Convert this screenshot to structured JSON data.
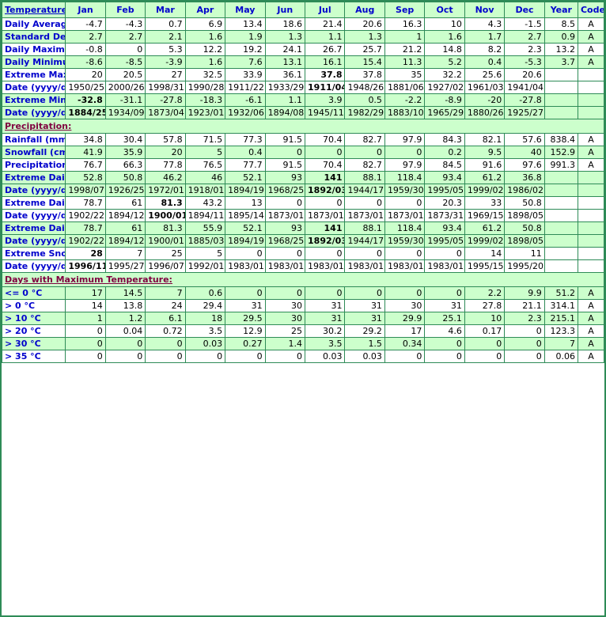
{
  "header": {
    "label": "Temperature:",
    "columns": [
      "Jan",
      "Feb",
      "Mar",
      "Apr",
      "May",
      "Jun",
      "Jul",
      "Aug",
      "Sep",
      "Oct",
      "Nov",
      "Dec",
      "Year",
      "Code"
    ]
  },
  "sections": {
    "precipitation": "Precipitation:",
    "days_max_temp": "Days with Maximum Temperature:"
  },
  "rows": [
    {
      "label": "Daily Average (°C)",
      "shade": "white",
      "values": [
        "-4.7",
        "-4.3",
        "0.7",
        "6.9",
        "13.4",
        "18.6",
        "21.4",
        "20.6",
        "16.3",
        "10",
        "4.3",
        "-1.5",
        "8.5"
      ],
      "code": "A",
      "bold": []
    },
    {
      "label": "Standard Deviation",
      "shade": "green",
      "values": [
        "2.7",
        "2.7",
        "2.1",
        "1.6",
        "1.9",
        "1.3",
        "1.1",
        "1.3",
        "1",
        "1.6",
        "1.7",
        "2.7",
        "0.9"
      ],
      "code": "A",
      "bold": []
    },
    {
      "label": "Daily Maximum (°C)",
      "shade": "white",
      "values": [
        "-0.8",
        "0",
        "5.3",
        "12.2",
        "19.2",
        "24.1",
        "26.7",
        "25.7",
        "21.2",
        "14.8",
        "8.2",
        "2.3",
        "13.2"
      ],
      "code": "A",
      "bold": []
    },
    {
      "label": "Daily Minimum (°C)",
      "shade": "green",
      "values": [
        "-8.6",
        "-8.5",
        "-3.9",
        "1.6",
        "7.6",
        "13.1",
        "16.1",
        "15.4",
        "11.3",
        "5.2",
        "0.4",
        "-5.3",
        "3.7"
      ],
      "code": "A",
      "bold": []
    },
    {
      "label": "Extreme Maximum (°C)",
      "shade": "white",
      "values": [
        "20",
        "20.5",
        "27",
        "32.5",
        "33.9",
        "36.1",
        "37.8",
        "37.8",
        "35",
        "32.2",
        "25.6",
        "20.6",
        ""
      ],
      "code": "",
      "bold": [
        6
      ]
    },
    {
      "label": "Date (yyyy/dd)",
      "shade": "white",
      "values": [
        "1950/25",
        "2000/26",
        "1998/31",
        "1990/28",
        "1911/22",
        "1933/29",
        "1911/04+",
        "1948/26",
        "1881/06",
        "1927/02",
        "1961/03",
        "1941/04",
        ""
      ],
      "code": "",
      "bold": [
        6
      ]
    },
    {
      "label": "Extreme Minimum (°C)",
      "shade": "green",
      "values": [
        "-32.8",
        "-31.1",
        "-27.8",
        "-18.3",
        "-6.1",
        "1.1",
        "3.9",
        "0.5",
        "-2.2",
        "-8.9",
        "-20",
        "-27.8",
        ""
      ],
      "code": "",
      "bold": [
        0
      ]
    },
    {
      "label": "Date (yyyy/dd)",
      "shade": "green",
      "values": [
        "1884/25",
        "1934/09",
        "1873/04",
        "1923/01",
        "1932/06",
        "1894/08+",
        "1945/11",
        "1982/29",
        "1883/10",
        "1965/29",
        "1880/26",
        "1925/27",
        ""
      ],
      "code": "",
      "bold": [
        0
      ]
    },
    {
      "label": "Rainfall (mm)",
      "shade": "white",
      "values": [
        "34.8",
        "30.4",
        "57.8",
        "71.5",
        "77.3",
        "91.5",
        "70.4",
        "82.7",
        "97.9",
        "84.3",
        "82.1",
        "57.6",
        "838.4"
      ],
      "code": "A",
      "bold": []
    },
    {
      "label": "Snowfall (cm)",
      "shade": "green",
      "values": [
        "41.9",
        "35.9",
        "20",
        "5",
        "0.4",
        "0",
        "0",
        "0",
        "0",
        "0.2",
        "9.5",
        "40",
        "152.9"
      ],
      "code": "A",
      "bold": []
    },
    {
      "label": "Precipitation (mm)",
      "shade": "white",
      "values": [
        "76.7",
        "66.3",
        "77.8",
        "76.5",
        "77.7",
        "91.5",
        "70.4",
        "82.7",
        "97.9",
        "84.5",
        "91.6",
        "97.6",
        "991.3"
      ],
      "code": "A",
      "bold": []
    },
    {
      "label": "Extreme Daily Rainfall (mm)",
      "shade": "green",
      "values": [
        "52.8",
        "50.8",
        "46.2",
        "46",
        "52.1",
        "93",
        "141",
        "88.1",
        "118.4",
        "93.4",
        "61.2",
        "36.8",
        ""
      ],
      "code": "",
      "bold": [
        6
      ]
    },
    {
      "label": "Date (yyyy/dd)",
      "shade": "green",
      "values": [
        "1998/07",
        "1926/25",
        "1972/01",
        "1918/01",
        "1894/19",
        "1968/25",
        "1892/03",
        "1944/17",
        "1959/30",
        "1995/05",
        "1999/02",
        "1986/02",
        ""
      ],
      "code": "",
      "bold": [
        6
      ]
    },
    {
      "label": "Extreme Daily Snowfall (cm)",
      "shade": "white",
      "values": [
        "78.7",
        "61",
        "81.3",
        "43.2",
        "13",
        "0",
        "0",
        "0",
        "0",
        "20.3",
        "33",
        "50.8",
        ""
      ],
      "code": "",
      "bold": [
        2
      ]
    },
    {
      "label": "Date (yyyy/dd)",
      "shade": "white",
      "values": [
        "1902/22",
        "1894/12",
        "1900/01",
        "1894/11",
        "1895/14",
        "1873/01+",
        "1873/01+",
        "1873/01+",
        "1873/01+",
        "1873/31",
        "1969/15",
        "1898/05",
        ""
      ],
      "code": "",
      "bold": [
        2
      ]
    },
    {
      "label": "Extreme Daily Precipitation (mm)",
      "shade": "green",
      "values": [
        "78.7",
        "61",
        "81.3",
        "55.9",
        "52.1",
        "93",
        "141",
        "88.1",
        "118.4",
        "93.4",
        "61.2",
        "50.8",
        ""
      ],
      "code": "",
      "bold": [
        6
      ]
    },
    {
      "label": "Date (yyyy/dd)",
      "shade": "green",
      "values": [
        "1902/22",
        "1894/12",
        "1900/01",
        "1885/03",
        "1894/19",
        "1968/25",
        "1892/03",
        "1944/17",
        "1959/30",
        "1995/05",
        "1999/02",
        "1898/05",
        ""
      ],
      "code": "",
      "bold": [
        6
      ]
    },
    {
      "label": "Extreme Snow Depth (cm)",
      "shade": "white",
      "values": [
        "28",
        "7",
        "25",
        "5",
        "0",
        "0",
        "0",
        "0",
        "0",
        "0",
        "14",
        "11",
        ""
      ],
      "code": "",
      "bold": [
        0
      ]
    },
    {
      "label": "Date (yyyy/dd)",
      "shade": "white",
      "values": [
        "1996/11",
        "1995/27",
        "1996/07",
        "1992/01",
        "1983/01+",
        "1983/01+",
        "1983/01+",
        "1983/01+",
        "1983/01+",
        "1983/01+",
        "1995/15",
        "1995/20",
        ""
      ],
      "code": "",
      "bold": [
        0
      ]
    },
    {
      "label": "<= 0 °C",
      "shade": "green",
      "values": [
        "17",
        "14.5",
        "7",
        "0.6",
        "0",
        "0",
        "0",
        "0",
        "0",
        "0",
        "2.2",
        "9.9",
        "51.2"
      ],
      "code": "A",
      "bold": []
    },
    {
      "label": "> 0 °C",
      "shade": "white",
      "values": [
        "14",
        "13.8",
        "24",
        "29.4",
        "31",
        "30",
        "31",
        "31",
        "30",
        "31",
        "27.8",
        "21.1",
        "314.1"
      ],
      "code": "A",
      "bold": []
    },
    {
      "label": "> 10 °C",
      "shade": "green",
      "values": [
        "1",
        "1.2",
        "6.1",
        "18",
        "29.5",
        "30",
        "31",
        "31",
        "29.9",
        "25.1",
        "10",
        "2.3",
        "215.1"
      ],
      "code": "A",
      "bold": []
    },
    {
      "label": "> 20 °C",
      "shade": "white",
      "values": [
        "0",
        "0.04",
        "0.72",
        "3.5",
        "12.9",
        "25",
        "30.2",
        "29.2",
        "17",
        "4.6",
        "0.17",
        "0",
        "123.3"
      ],
      "code": "A",
      "bold": []
    },
    {
      "label": "> 30 °C",
      "shade": "green",
      "values": [
        "0",
        "0",
        "0",
        "0.03",
        "0.27",
        "1.4",
        "3.5",
        "1.5",
        "0.34",
        "0",
        "0",
        "0",
        "7"
      ],
      "code": "A",
      "bold": []
    },
    {
      "label": "> 35 °C",
      "shade": "white",
      "values": [
        "0",
        "0",
        "0",
        "0",
        "0",
        "0",
        "0.03",
        "0.03",
        "0",
        "0",
        "0",
        "0",
        "0.06"
      ],
      "code": "A",
      "bold": []
    }
  ]
}
